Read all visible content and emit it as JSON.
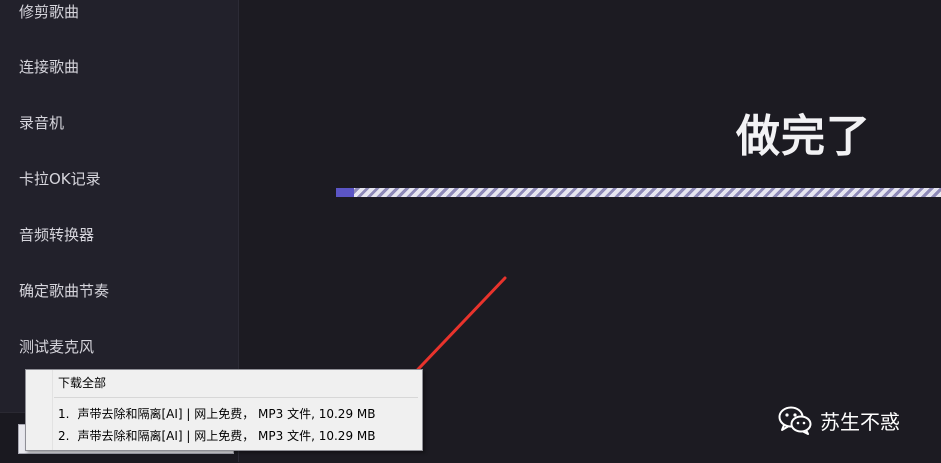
{
  "sidebar": {
    "items": [
      {
        "label": "修剪歌曲"
      },
      {
        "label": "连接歌曲"
      },
      {
        "label": "录音机"
      },
      {
        "label": "卡拉OK记录"
      },
      {
        "label": "音频转换器"
      },
      {
        "label": "确定歌曲节奏"
      },
      {
        "label": "测试麦克风"
      }
    ]
  },
  "main": {
    "status_title": "做完了",
    "progress_fraction": 0.03
  },
  "popup": {
    "header": "下载全部",
    "items": [
      {
        "index": "1.",
        "text": "声带去除和隔离[AI] | 网上免费， MP3 文件, 10.29 MB"
      },
      {
        "index": "2.",
        "text": "声带去除和隔离[AI] | 网上免费， MP3 文件, 10.29 MB"
      }
    ]
  },
  "watermark": {
    "text": "苏生不惑",
    "icon": "wechat-icon"
  },
  "annotation": {
    "arrow_color": "#e8332c"
  }
}
